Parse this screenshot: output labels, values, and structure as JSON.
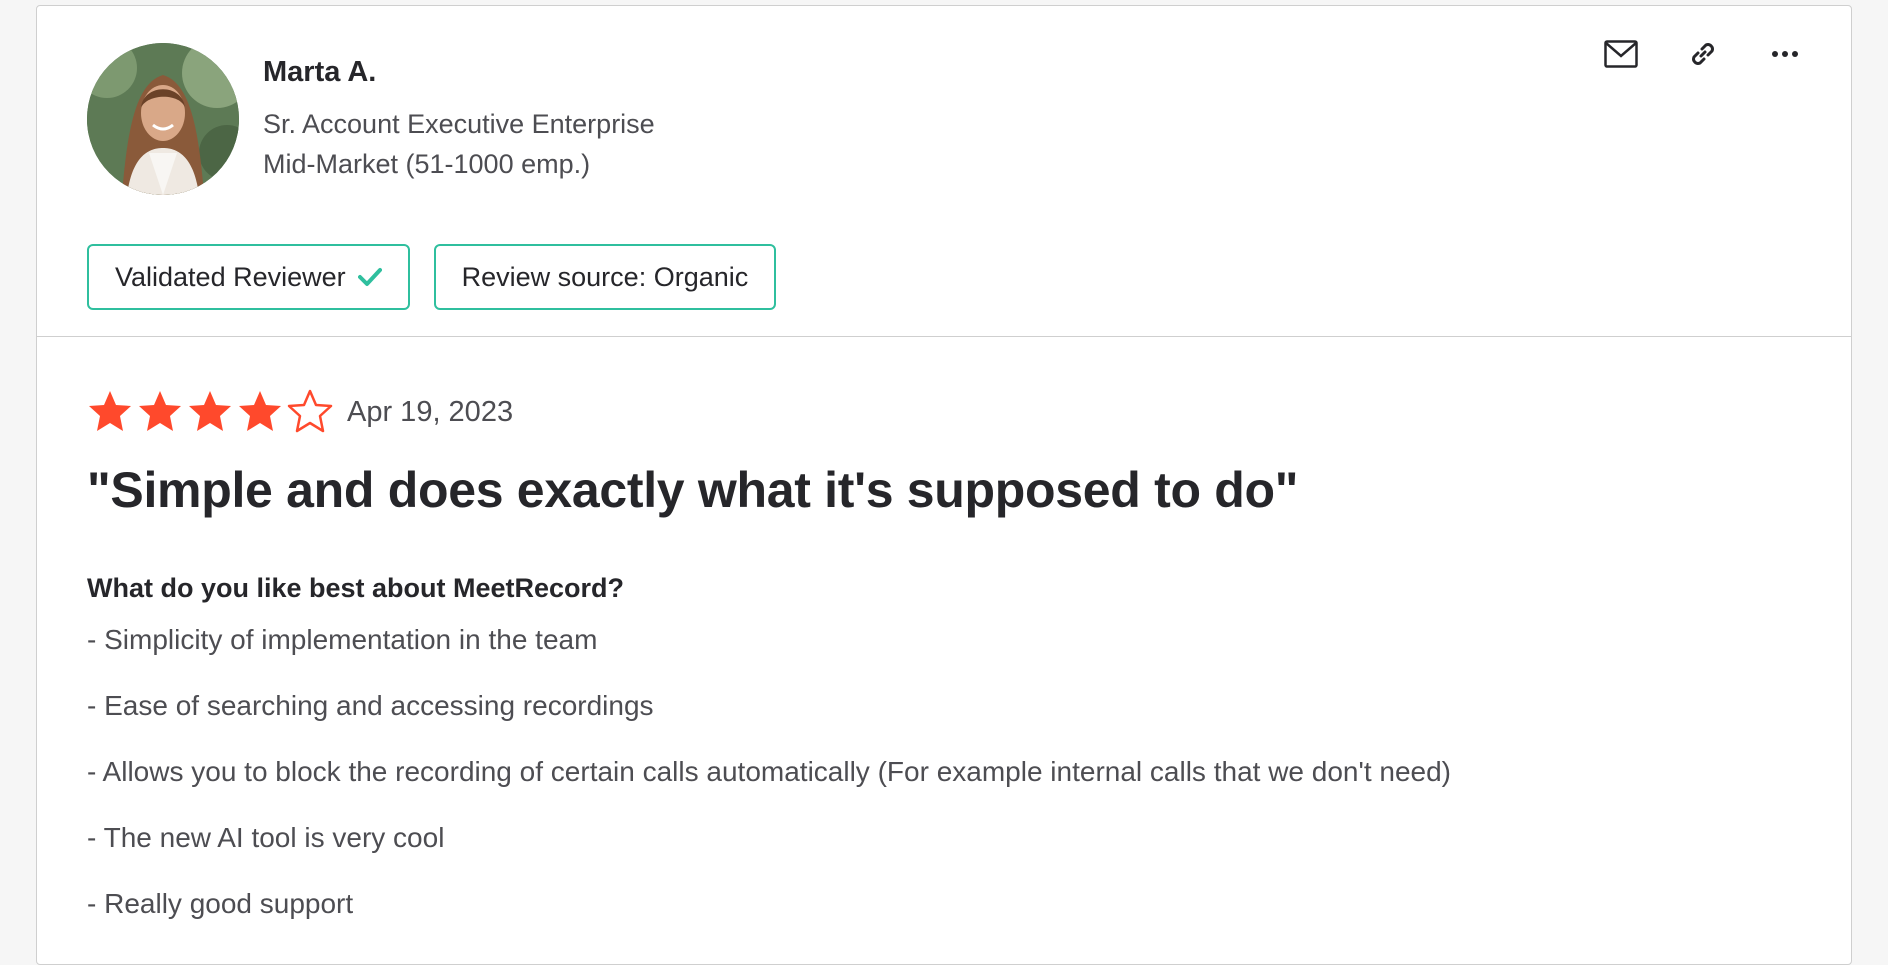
{
  "reviewer": {
    "name": "Marta A.",
    "role": "Sr. Account Executive Enterprise",
    "segment": "Mid-Market (51-1000 emp.)"
  },
  "actions": {
    "email_icon": "envelope-icon",
    "link_icon": "link-icon",
    "more_icon": "ellipsis-icon"
  },
  "badges": {
    "validated": "Validated Reviewer",
    "source": "Review source: Organic"
  },
  "review": {
    "rating": 4,
    "max_rating": 5,
    "date": "Apr 19, 2023",
    "title": "\"Simple and does exactly what it's supposed to do\"",
    "question": "What do you like best about MeetRecord?",
    "answers": [
      "- Simplicity of implementation in the team",
      "- Ease of searching and accessing recordings",
      "- Allows you to block the recording of certain calls automatically (For example internal calls that we don't need)",
      "- The new AI tool is very cool",
      "- Really good support"
    ]
  },
  "colors": {
    "star": "#ff492c",
    "badge_border": "#2fbf9e",
    "check": "#2fbf9e"
  }
}
